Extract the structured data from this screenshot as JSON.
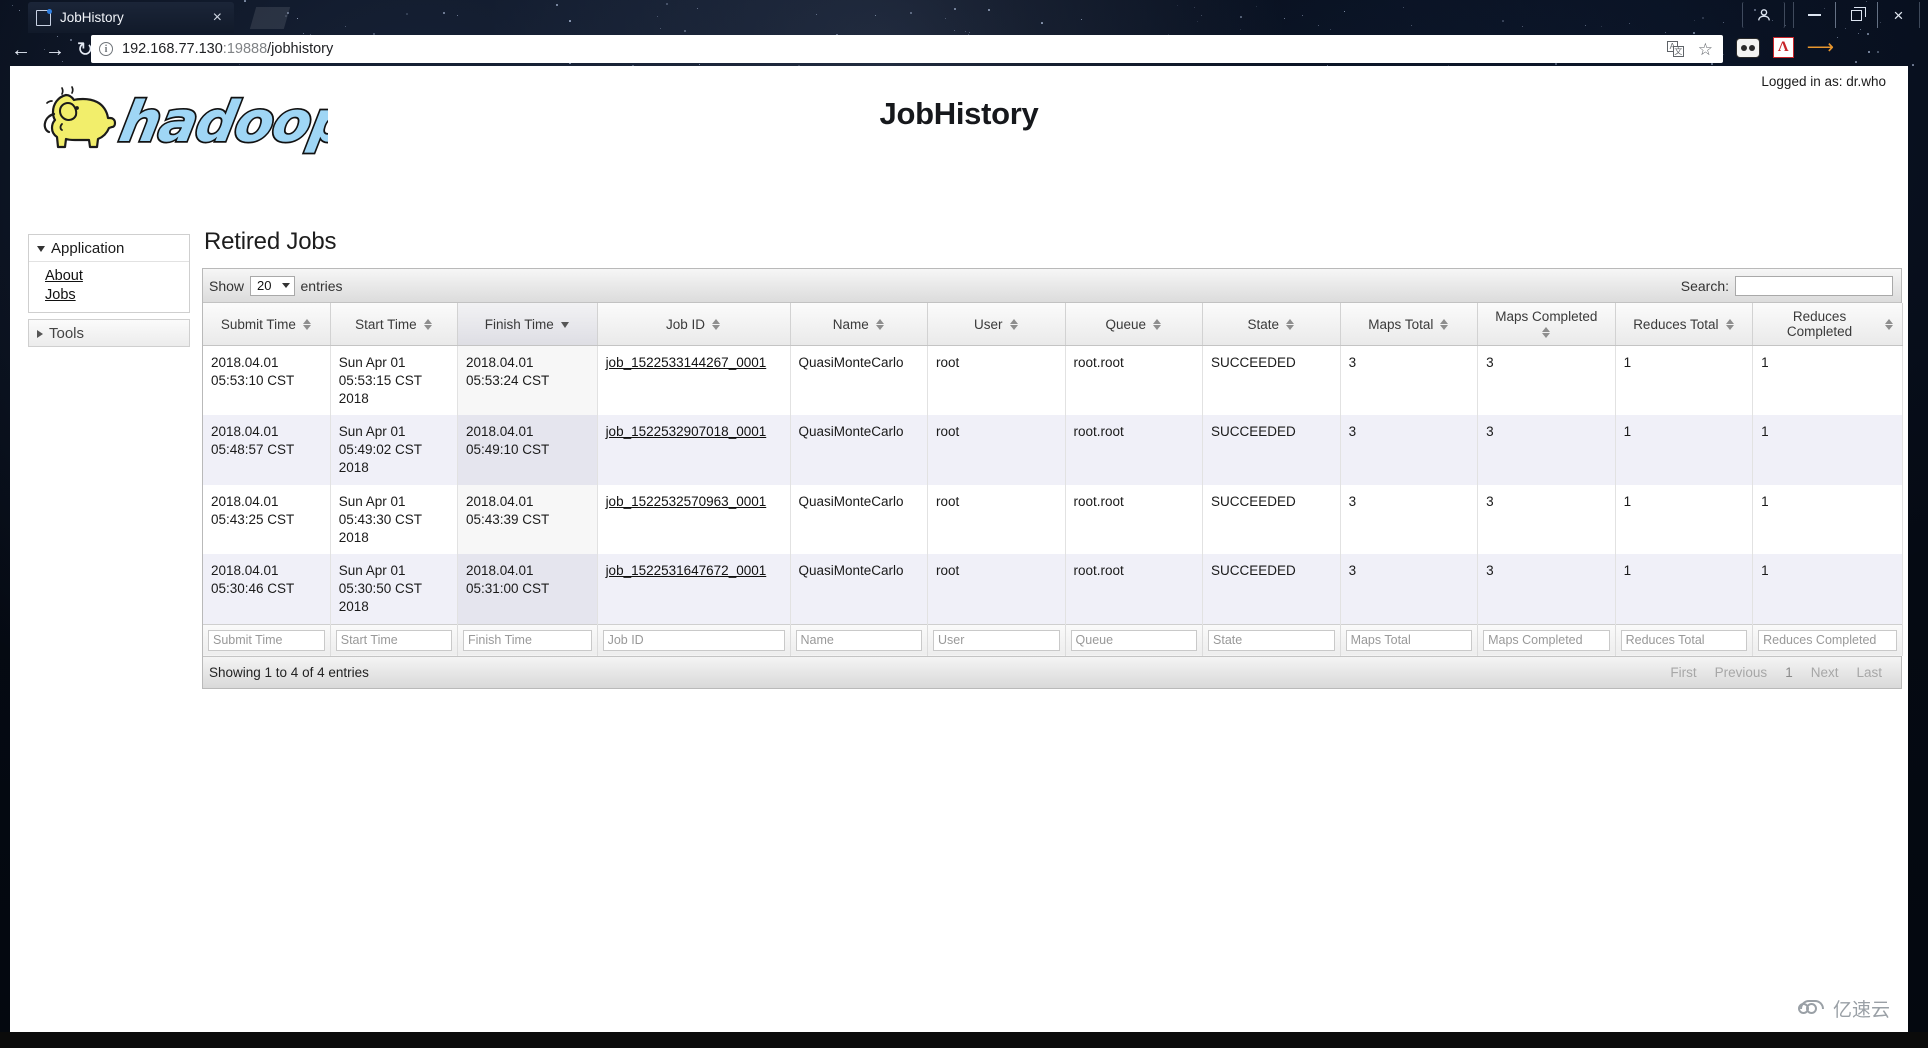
{
  "browser": {
    "tab": {
      "title": "JobHistory",
      "favicon": "page-icon",
      "close": "×"
    },
    "nav": {
      "back": "←",
      "forward": "→",
      "reload": "↻"
    },
    "omnibox": {
      "security_label": "i",
      "url_host": "192.168.77.130",
      "url_port": ":19888",
      "url_path": "/jobhistory",
      "translate_icon": "translate-icon",
      "bookmark_icon": "star-icon"
    },
    "extensions": [
      "oo-extension-icon",
      "pdf-extension-icon",
      "download-arrow-icon"
    ],
    "window_controls": {
      "account": "⚹",
      "minimize": "minimize-icon",
      "maximize": "maximize-icon",
      "close": "×"
    }
  },
  "page": {
    "logo_alt": "hadoop",
    "logo_text": "hadoop",
    "title": "JobHistory",
    "logged_in": "Logged in as: dr.who",
    "section_title": "Retired Jobs"
  },
  "sidebar": {
    "groups": [
      {
        "label": "Application",
        "expanded": true,
        "items": [
          {
            "label": "About"
          },
          {
            "label": "Jobs"
          }
        ]
      },
      {
        "label": "Tools",
        "expanded": false,
        "items": []
      }
    ]
  },
  "datatable": {
    "length_label_before": "Show",
    "length_value": "20",
    "length_label_after": "entries",
    "search_label": "Search:",
    "search_value": "",
    "search_placeholder": "",
    "columns": [
      {
        "label": "Submit Time",
        "sort": "both",
        "align": "center"
      },
      {
        "label": "Start Time",
        "sort": "both",
        "align": "center"
      },
      {
        "label": "Finish Time",
        "sort": "desc",
        "align": "center"
      },
      {
        "label": "Job ID",
        "sort": "both",
        "align": "center"
      },
      {
        "label": "Name",
        "sort": "both",
        "align": "center"
      },
      {
        "label": "User",
        "sort": "both",
        "align": "center"
      },
      {
        "label": "Queue",
        "sort": "both",
        "align": "center"
      },
      {
        "label": "State",
        "sort": "both",
        "align": "center"
      },
      {
        "label": "Maps Total",
        "sort": "both",
        "align": "center"
      },
      {
        "label": "Maps Completed",
        "sort": "both",
        "align": "center"
      },
      {
        "label": "Reduces Total",
        "sort": "both",
        "align": "center"
      },
      {
        "label": "Reduces Completed",
        "sort": "both",
        "align": "center"
      }
    ],
    "rows": [
      {
        "submit_time": "2018.04.01 05:53:10 CST",
        "start_time": "Sun Apr 01 05:53:15 CST 2018",
        "finish_time": "2018.04.01 05:53:24 CST",
        "job_id": "job_1522533144267_0001",
        "name": "QuasiMonteCarlo",
        "user": "root",
        "queue": "root.root",
        "state": "SUCCEEDED",
        "maps_total": "3",
        "maps_completed": "3",
        "reduces_total": "1",
        "reduces_completed": "1"
      },
      {
        "submit_time": "2018.04.01 05:48:57 CST",
        "start_time": "Sun Apr 01 05:49:02 CST 2018",
        "finish_time": "2018.04.01 05:49:10 CST",
        "job_id": "job_1522532907018_0001",
        "name": "QuasiMonteCarlo",
        "user": "root",
        "queue": "root.root",
        "state": "SUCCEEDED",
        "maps_total": "3",
        "maps_completed": "3",
        "reduces_total": "1",
        "reduces_completed": "1"
      },
      {
        "submit_time": "2018.04.01 05:43:25 CST",
        "start_time": "Sun Apr 01 05:43:30 CST 2018",
        "finish_time": "2018.04.01 05:43:39 CST",
        "job_id": "job_1522532570963_0001",
        "name": "QuasiMonteCarlo",
        "user": "root",
        "queue": "root.root",
        "state": "SUCCEEDED",
        "maps_total": "3",
        "maps_completed": "3",
        "reduces_total": "1",
        "reduces_completed": "1"
      },
      {
        "submit_time": "2018.04.01 05:30:46 CST",
        "start_time": "Sun Apr 01 05:30:50 CST 2018",
        "finish_time": "2018.04.01 05:31:00 CST",
        "job_id": "job_1522531647672_0001",
        "name": "QuasiMonteCarlo",
        "user": "root",
        "queue": "root.root",
        "state": "SUCCEEDED",
        "maps_total": "3",
        "maps_completed": "3",
        "reduces_total": "1",
        "reduces_completed": "1"
      }
    ],
    "filters": [
      "Submit Time",
      "Start Time",
      "Finish Time",
      "Job ID",
      "Name",
      "User",
      "Queue",
      "State",
      "Maps Total",
      "Maps Completed",
      "Reduces Total",
      "Reduces Completed"
    ],
    "info": "Showing 1 to 4 of 4 entries",
    "paginate": {
      "first": "First",
      "previous": "Previous",
      "pages": [
        "1"
      ],
      "next": "Next",
      "last": "Last"
    }
  },
  "watermark": {
    "text": "亿速云",
    "icon": "cloud-icon"
  },
  "colors": {
    "logo_blue": "#9fd6f5",
    "logo_yellow": "#f2ee6b",
    "row_even": "#f0f0f8",
    "sorted_col": "#e5e5ee"
  }
}
